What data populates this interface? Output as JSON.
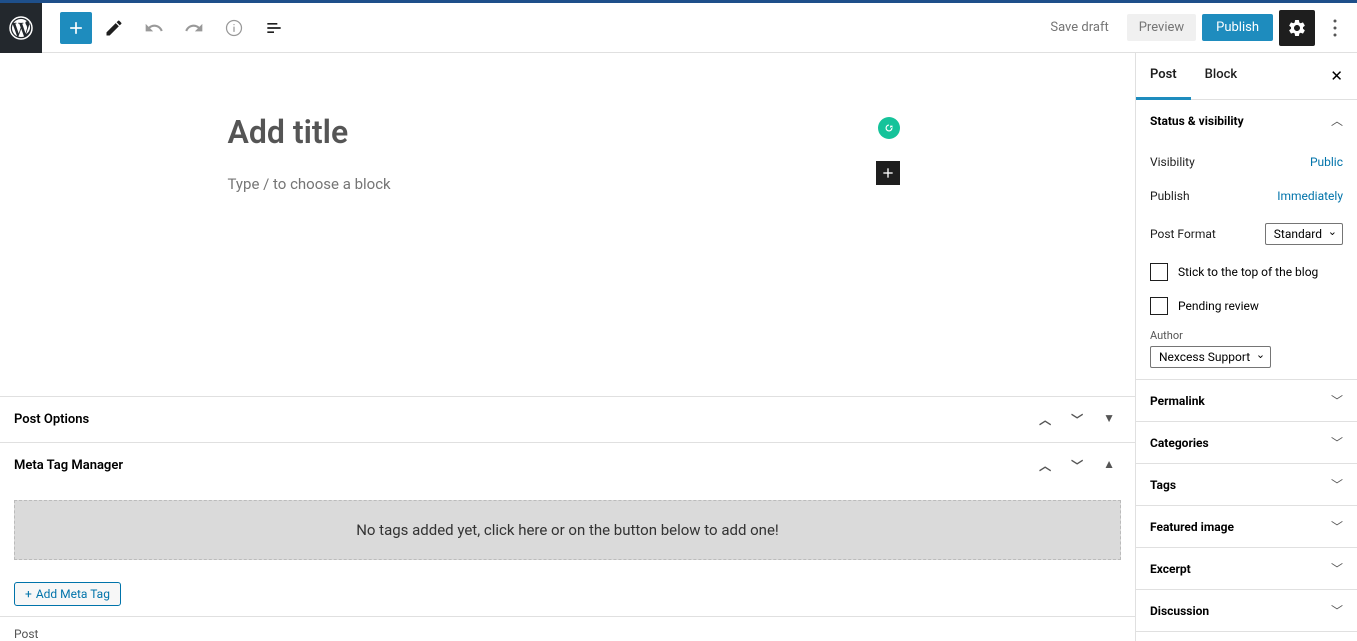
{
  "toolbar": {
    "save_draft": "Save draft",
    "preview": "Preview",
    "publish": "Publish"
  },
  "editor": {
    "title_placeholder": "Add title",
    "block_placeholder": "Type / to choose a block"
  },
  "panels": {
    "post_options": "Post Options",
    "meta_tag_manager": "Meta Tag Manager",
    "no_tags_message": "No tags added yet, click here or on the button below to add one!",
    "add_meta_tag": "Add Meta Tag",
    "post_footer": "Post"
  },
  "sidebar": {
    "tabs": {
      "post": "Post",
      "block": "Block"
    },
    "sections": {
      "status_visibility": {
        "title": "Status & visibility",
        "visibility_label": "Visibility",
        "visibility_value": "Public",
        "publish_label": "Publish",
        "publish_value": "Immediately",
        "post_format_label": "Post Format",
        "post_format_value": "Standard",
        "sticky_label": "Stick to the top of the blog",
        "pending_label": "Pending review",
        "author_label": "Author",
        "author_value": "Nexcess Support"
      },
      "permalink": "Permalink",
      "categories": "Categories",
      "tags": "Tags",
      "featured_image": "Featured image",
      "excerpt": "Excerpt",
      "discussion": "Discussion"
    }
  }
}
